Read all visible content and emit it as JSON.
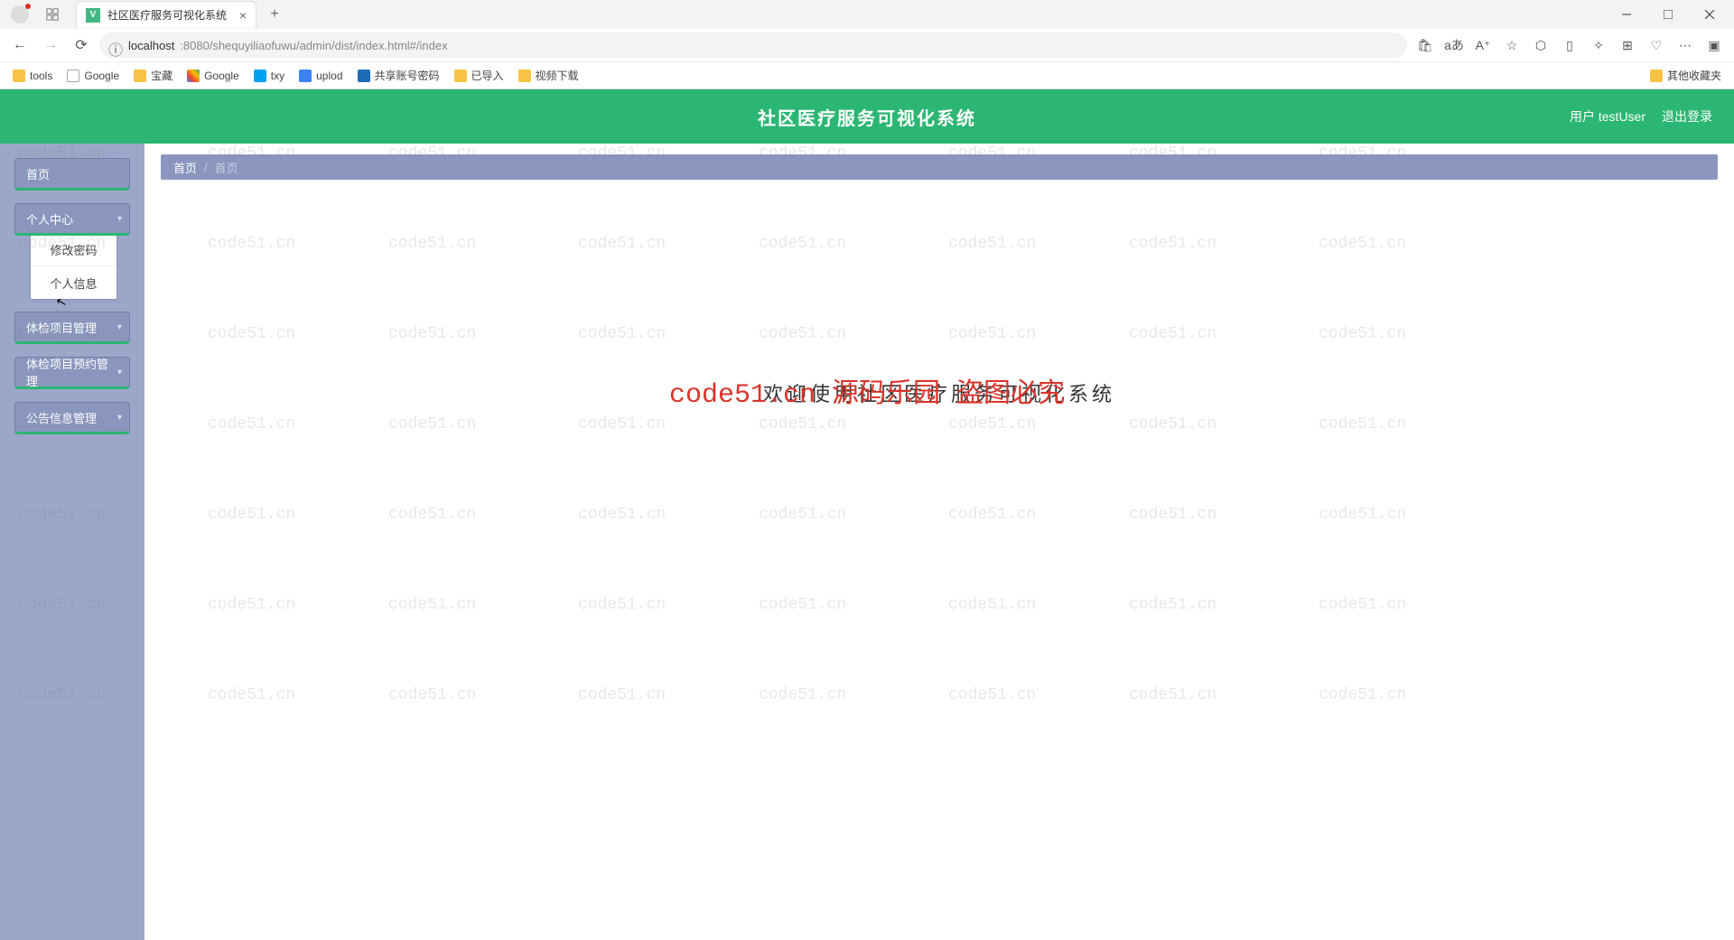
{
  "browser": {
    "tab_title": "社区医疗服务可视化系统",
    "url_host": "localhost",
    "url_path": ":8080/shequyiliaofuwu/admin/dist/index.html#/index",
    "bookmarks": [
      "tools",
      "Google",
      "宝藏",
      "Google",
      "txy",
      "uplod",
      "共享账号密码",
      "已导入",
      "视频下载"
    ],
    "other_bookmarks": "其他收藏夹",
    "aa_label": "aあ"
  },
  "header": {
    "title": "社区医疗服务可视化系统",
    "user_label": "用户 testUser",
    "logout": "退出登录"
  },
  "sidebar": {
    "home": "首页",
    "personal": "个人中心",
    "personal_sub": [
      "修改密码",
      "个人信息"
    ],
    "checkup": "体检项目管理",
    "checkup_reserve": "体检项目预约管理",
    "notice": "公告信息管理"
  },
  "breadcrumb": {
    "root": "首页",
    "current": "首页"
  },
  "main": {
    "welcome": "欢迎使用社区医疗服务可视化系统"
  },
  "watermark": {
    "text": "code51.cn",
    "overlay": "code51.cn 源码乐园 盗图必究"
  }
}
